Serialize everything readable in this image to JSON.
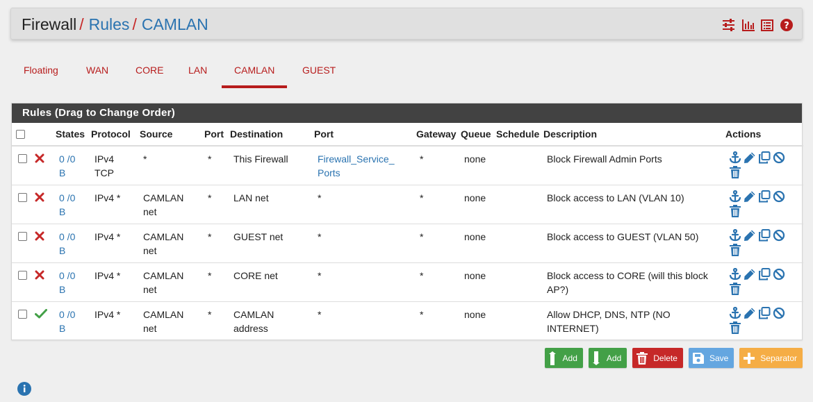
{
  "breadcrumb": {
    "firewall": "Firewall",
    "rules": "Rules",
    "interface": "CAMLAN",
    "separator": "/"
  },
  "header_icons": [
    "sliders-icon",
    "bar-chart-icon",
    "list-icon",
    "help-icon"
  ],
  "tabs": [
    {
      "label": "Floating"
    },
    {
      "label": "WAN"
    },
    {
      "label": "CORE"
    },
    {
      "label": "LAN"
    },
    {
      "label": "CAMLAN",
      "active": true
    },
    {
      "label": "GUEST"
    }
  ],
  "panel": {
    "title": "Rules (Drag to Change Order)"
  },
  "table": {
    "headers": [
      "States",
      "Protocol",
      "Source",
      "Port",
      "Destination",
      "Port",
      "Gateway",
      "Queue",
      "Schedule",
      "Description",
      "Actions"
    ],
    "rows": [
      {
        "action": "block",
        "states_line1": "0 /0",
        "states_line2": "B",
        "protocol_line1": "IPv4",
        "protocol_line2": "TCP",
        "source_line1": "*",
        "source_line2": "",
        "src_port": "*",
        "dest_line1": "This Firewall",
        "dest_line2": "",
        "dst_port_line1": "Firewall_Service_",
        "dst_port_line2": "Ports",
        "dst_port_link": true,
        "gateway": "*",
        "queue": "none",
        "schedule": "",
        "description": "Block Firewall Admin Ports"
      },
      {
        "action": "block",
        "states_line1": "0 /0",
        "states_line2": "B",
        "protocol_line1": "IPv4 *",
        "protocol_line2": "",
        "source_line1": "CAMLAN",
        "source_line2": "net",
        "src_port": "*",
        "dest_line1": "LAN net",
        "dest_line2": "",
        "dst_port_line1": "*",
        "dst_port_line2": "",
        "dst_port_link": false,
        "gateway": "*",
        "queue": "none",
        "schedule": "",
        "description": "Block access to LAN (VLAN 10)"
      },
      {
        "action": "block",
        "states_line1": "0 /0",
        "states_line2": "B",
        "protocol_line1": "IPv4 *",
        "protocol_line2": "",
        "source_line1": "CAMLAN",
        "source_line2": "net",
        "src_port": "*",
        "dest_line1": "GUEST net",
        "dest_line2": "",
        "dst_port_line1": "*",
        "dst_port_line2": "",
        "dst_port_link": false,
        "gateway": "*",
        "queue": "none",
        "schedule": "",
        "description": "Block access to GUEST (VLAN 50)"
      },
      {
        "action": "block",
        "states_line1": "0 /0",
        "states_line2": "B",
        "protocol_line1": "IPv4 *",
        "protocol_line2": "",
        "source_line1": "CAMLAN",
        "source_line2": "net",
        "src_port": "*",
        "dest_line1": "CORE net",
        "dest_line2": "",
        "dst_port_line1": "*",
        "dst_port_line2": "",
        "dst_port_link": false,
        "gateway": "*",
        "queue": "none",
        "schedule": "",
        "description": "Block access to CORE (will this block AP?)"
      },
      {
        "action": "pass",
        "states_line1": "0 /0",
        "states_line2": "B",
        "protocol_line1": "IPv4 *",
        "protocol_line2": "",
        "source_line1": "CAMLAN",
        "source_line2": "net",
        "src_port": "*",
        "dest_line1": "CAMLAN",
        "dest_line2": "address",
        "dst_port_line1": "*",
        "dst_port_line2": "",
        "dst_port_link": false,
        "gateway": "*",
        "queue": "none",
        "schedule": "",
        "description": "Allow DHCP, DNS, NTP (NO INTERNET)"
      }
    ],
    "row_action_icons": [
      "anchor-icon",
      "pencil-icon",
      "copy-icon",
      "disable-icon",
      "trash-icon"
    ]
  },
  "buttons": {
    "add_top": "Add",
    "add_bottom": "Add",
    "delete": "Delete",
    "save": "Save",
    "separator": "Separator"
  },
  "colors": {
    "brand_red": "#b71c1c",
    "link_blue": "#2a73b0",
    "panel_header": "#424242",
    "pass_green": "#43a047",
    "block_red": "#c62828"
  }
}
